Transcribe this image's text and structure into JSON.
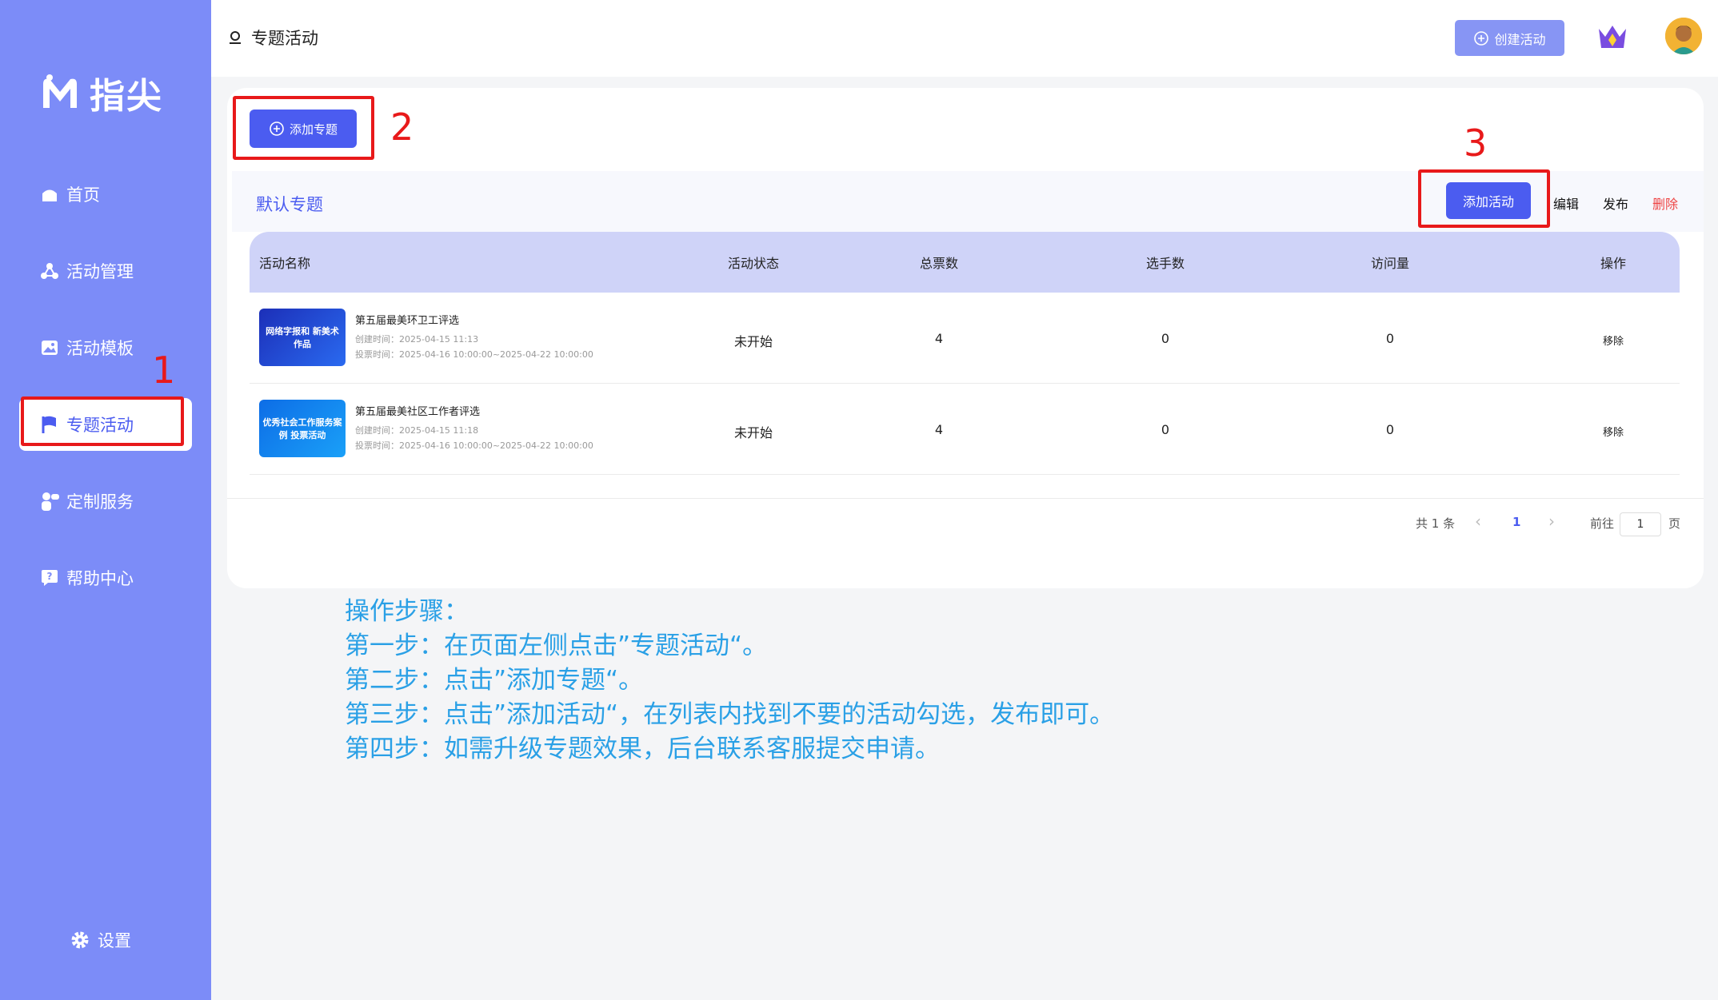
{
  "brand": {
    "name": "指尖"
  },
  "sidebar": {
    "items": [
      {
        "label": "首页",
        "icon": "home-icon"
      },
      {
        "label": "活动管理",
        "icon": "network-icon"
      },
      {
        "label": "活动模板",
        "icon": "image-icon"
      },
      {
        "label": "专题活动",
        "icon": "flag-icon",
        "active": true
      },
      {
        "label": "定制服务",
        "icon": "service-icon"
      },
      {
        "label": "帮助中心",
        "icon": "help-icon"
      }
    ],
    "settings_label": "设置"
  },
  "header": {
    "title": "专题活动",
    "create_label": "创建活动"
  },
  "content": {
    "add_topic_label": "添加专题",
    "topic": {
      "name": "默认专题",
      "add_activity_label": "添加活动",
      "edit_label": "编辑",
      "publish_label": "发布",
      "delete_label": "删除"
    },
    "table": {
      "columns": [
        "活动名称",
        "活动状态",
        "总票数",
        "选手数",
        "访问量",
        "操作"
      ],
      "rows": [
        {
          "thumb_text": "网络字报和 新美术作品",
          "title": "第五届最美环卫工评选",
          "created": "创建时间：2025-04-15 11:13",
          "vote_time": "投票时间：2025-04-16 10:00:00~2025-04-22 10:00:00",
          "status": "未开始",
          "votes": "4",
          "players": "0",
          "visits": "0",
          "action": "移除"
        },
        {
          "thumb_text": "优秀社会工作服务案例 投票活动",
          "title": "第五届最美社区工作者评选",
          "created": "创建时间：2025-04-15 11:18",
          "vote_time": "投票时间：2025-04-16 10:00:00~2025-04-22 10:00:00",
          "status": "未开始",
          "votes": "4",
          "players": "0",
          "visits": "0",
          "action": "移除"
        }
      ]
    },
    "pagination": {
      "total": "共 1 条",
      "prev": "‹",
      "current": "1",
      "next": "›",
      "goto_label": "前往",
      "goto_value": "1",
      "page_suffix": "页"
    }
  },
  "annotations": {
    "step1": "1",
    "step2": "2",
    "step3": "3",
    "color": "#e8191a"
  },
  "instructions": [
    "操作步骤：",
    "第一步：在页面左侧点击”专题活动“。",
    "第二步：点击”添加专题“。",
    "第三步：点击”添加活动“，在列表内找到不要的活动勾选，发布即可。",
    "第四步：如需升级专题效果，后台联系客服提交申请。"
  ],
  "colors": {
    "sidebar": "#7c8cf8",
    "primary": "#4b5cf0",
    "danger": "#ee4444",
    "instruction_text": "#2aa0e6"
  }
}
